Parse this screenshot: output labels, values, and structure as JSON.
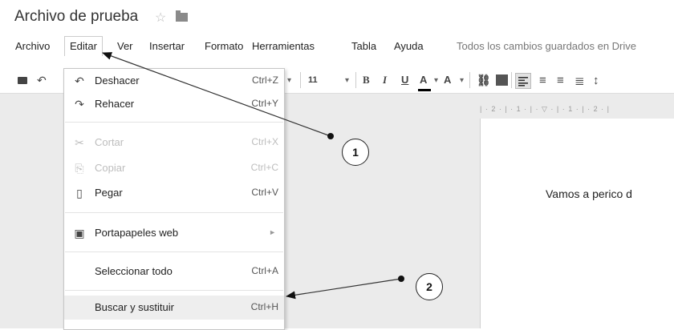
{
  "title": {
    "doc_name": "Archivo de prueba",
    "star": "☆"
  },
  "menubar": {
    "items": [
      "Archivo",
      "Editar",
      "Ver",
      "Insertar",
      "Formato",
      "Herramientas",
      "Tabla",
      "Ayuda"
    ],
    "status": "Todos los cambios guardados en Drive"
  },
  "toolbar": {
    "font_size": "11",
    "bold": "B",
    "italic": "I",
    "underline": "U",
    "font_color": "A",
    "highlight": "A",
    "link": "⛓",
    "undo": "↶",
    "dropdown": "▾",
    "align_center": "≡",
    "align_right": "≡",
    "justify": "≣",
    "line_spacing": "↕"
  },
  "edit_menu": {
    "items": [
      {
        "label": "Deshacer",
        "shortcut": "Ctrl+Z",
        "icon": "undo-icon",
        "glyph": "↶"
      },
      {
        "label": "Rehacer",
        "shortcut": "Ctrl+Y",
        "icon": "redo-icon",
        "glyph": "↷"
      },
      {
        "label": "Cortar",
        "shortcut": "Ctrl+X",
        "icon": "scissors-icon",
        "glyph": "✂"
      },
      {
        "label": "Copiar",
        "shortcut": "Ctrl+C",
        "icon": "copy-icon",
        "glyph": "⎘"
      },
      {
        "label": "Pegar",
        "shortcut": "Ctrl+V",
        "icon": "paste-icon",
        "glyph": "▯"
      },
      {
        "label": "Portapapeles web",
        "shortcut": "",
        "icon": "clipboard-icon",
        "glyph": "▣",
        "submenu": "►"
      },
      {
        "label": "Seleccionar todo",
        "shortcut": "Ctrl+A"
      },
      {
        "label": "Buscar y sustituir",
        "shortcut": "Ctrl+H"
      }
    ]
  },
  "ruler": "| · 2 · | · 1 · | · ▽ · | · 1 · | · 2 · |",
  "document": {
    "visible_text": "Vamos a perico d"
  },
  "callouts": [
    "1",
    "2"
  ]
}
